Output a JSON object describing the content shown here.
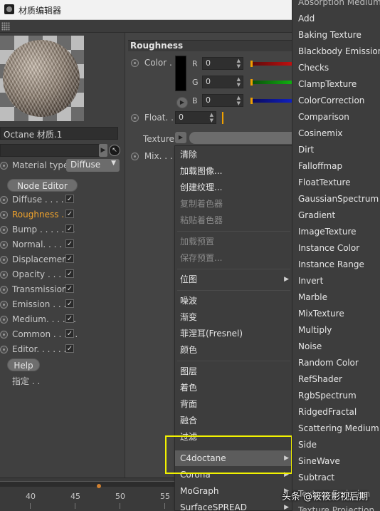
{
  "window": {
    "title": "材质编辑器"
  },
  "left_panel": {
    "material_name": "Octane 材质.1",
    "material_type_label": "Material type",
    "material_type_value": "Diffuse",
    "node_editor_label": "Node Editor",
    "channels": [
      {
        "label": "Diffuse . . . . . .",
        "checked": "✓",
        "active": false
      },
      {
        "label": "Roughness . .",
        "checked": "✓",
        "active": true
      },
      {
        "label": "Bump . . . . . . .",
        "checked": "✓",
        "active": false
      },
      {
        "label": "Normal. . . . . .",
        "checked": "✓",
        "active": false
      },
      {
        "label": "Displacement",
        "checked": "✓",
        "active": false
      },
      {
        "label": "Opacity . . . . .",
        "checked": "✓",
        "active": false
      },
      {
        "label": "Transmission",
        "checked": "✓",
        "active": false
      },
      {
        "label": "Emission . . . .",
        "checked": "✓",
        "active": false
      },
      {
        "label": "Medium. . . . . .",
        "checked": "✓",
        "active": false
      },
      {
        "label": "Common . . . . .",
        "checked": "✓",
        "active": false
      },
      {
        "label": "Editor. . . . . . .",
        "checked": "✓",
        "active": false
      }
    ],
    "help_label": "Help",
    "assign_label": "指定 . ."
  },
  "roughness_panel": {
    "section_title": "Roughness",
    "color_label": "Color . .",
    "r_label": "R",
    "g_label": "G",
    "b_label": "B",
    "r_value": "0",
    "g_value": "0",
    "b_value": "0",
    "float_label": "Float. .",
    "float_value": "0",
    "texture_label": "Texture",
    "mix_label": "Mix. . ."
  },
  "context_menu": {
    "items": [
      {
        "label": "清除",
        "disabled": false
      },
      {
        "label": "加载图像...",
        "disabled": false
      },
      {
        "label": "创建纹理...",
        "disabled": false
      },
      {
        "label": "复制着色器",
        "disabled": true
      },
      {
        "label": "粘贴着色器",
        "disabled": true
      },
      {
        "label": "加载预置",
        "disabled": true
      },
      {
        "label": "保存预置...",
        "disabled": true
      },
      {
        "label": "位图",
        "disabled": false
      },
      {
        "label": "噪波",
        "disabled": false
      },
      {
        "label": "渐变",
        "disabled": false
      },
      {
        "label": "菲涅耳(Fresnel)",
        "disabled": false
      },
      {
        "label": "颜色",
        "disabled": false
      },
      {
        "label": "图层",
        "disabled": false
      },
      {
        "label": "着色",
        "disabled": false
      },
      {
        "label": "背面",
        "disabled": false
      },
      {
        "label": "融合",
        "disabled": false
      },
      {
        "label": "过滤",
        "disabled": false
      },
      {
        "label": "C4doctane",
        "disabled": false
      },
      {
        "label": "Corona",
        "disabled": false
      },
      {
        "label": "MoGraph",
        "disabled": false
      },
      {
        "label": "SurfaceSPREAD",
        "disabled": false
      }
    ]
  },
  "submenu": {
    "items": [
      "Absorption Medium",
      "Add",
      "Baking Texture",
      "Blackbody Emission",
      "Checks",
      "ClampTexture",
      "ColorCorrection",
      "Comparison",
      "Cosinemix",
      "Dirt",
      "Falloffmap",
      "FloatTexture",
      "GaussianSpectrum",
      "Gradient",
      "ImageTexture",
      "Instance Color",
      "Instance Range",
      "Invert",
      "Marble",
      "MixTexture",
      "Multiply",
      "Noise",
      "Random Color",
      "RefShader",
      "RgbSpectrum",
      "RidgedFractal",
      "Scattering Medium",
      "Side",
      "SineWave",
      "Subtract",
      "Texture Emission",
      "Texture Projection"
    ]
  },
  "timeline": {
    "ticks": [
      "40",
      "45",
      "50",
      "55"
    ]
  },
  "watermark": "头条 @筱筱影视后期",
  "colors": {
    "active_channel": "#f0a32c",
    "highlight_box": "#f2f200",
    "menu_bg": "#3d3d3d"
  }
}
